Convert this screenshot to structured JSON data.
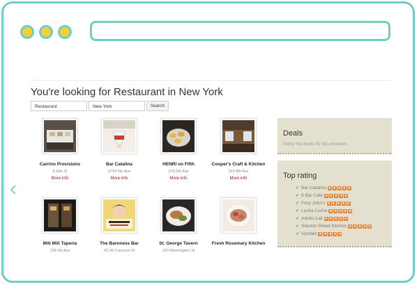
{
  "browser": {
    "url": ""
  },
  "page": {
    "title": "You're looking for Restaurant in New York",
    "search": {
      "what_value": "Restaurant",
      "where_value": "New York",
      "button_label": "Search"
    }
  },
  "colors": {
    "frame": "#6ccfc3",
    "dot": "#f4cf3a",
    "link": "#a31b1b",
    "panel": "#e4e0cf",
    "star": "#e8833a"
  },
  "restaurants": [
    {
      "name": "Carrino Provisions",
      "address": "8 Elle St",
      "more": "More info"
    },
    {
      "name": "Bar Catalina",
      "address": "6754 5th Ave",
      "more": "More info"
    },
    {
      "name": "HENRI on Fifth",
      "address": "279 5th Ave",
      "more": "More info"
    },
    {
      "name": "Cooper's Craft & Kitchen",
      "address": "169 8th Ave",
      "more": "More info"
    },
    {
      "name": "Miti Miti Taperia",
      "address": "138 5th Ave"
    },
    {
      "name": "The Baroness Bar",
      "address": "41-26 Crescent St"
    },
    {
      "name": "St. George Tavern",
      "address": "103 Washington St"
    },
    {
      "name": "Fresh Rosemary Kitchen",
      "address": ""
    }
  ],
  "deals": {
    "title": "Deals",
    "text": "Sorry! No deals for this moment"
  },
  "top_rating": {
    "title": "Top rating",
    "items": [
      {
        "name": "Bar Catalina",
        "stars": 5
      },
      {
        "name": "9 Bar Cafe",
        "stars": 5
      },
      {
        "name": "Foxy John's",
        "stars": 5
      },
      {
        "name": "Lucha Lucha",
        "stars": 5
      },
      {
        "name": "Adobo Lali",
        "stars": 5
      },
      {
        "name": "Stanton Street Kitchen",
        "stars": 5
      },
      {
        "name": "Upstate",
        "stars": 5
      }
    ]
  }
}
